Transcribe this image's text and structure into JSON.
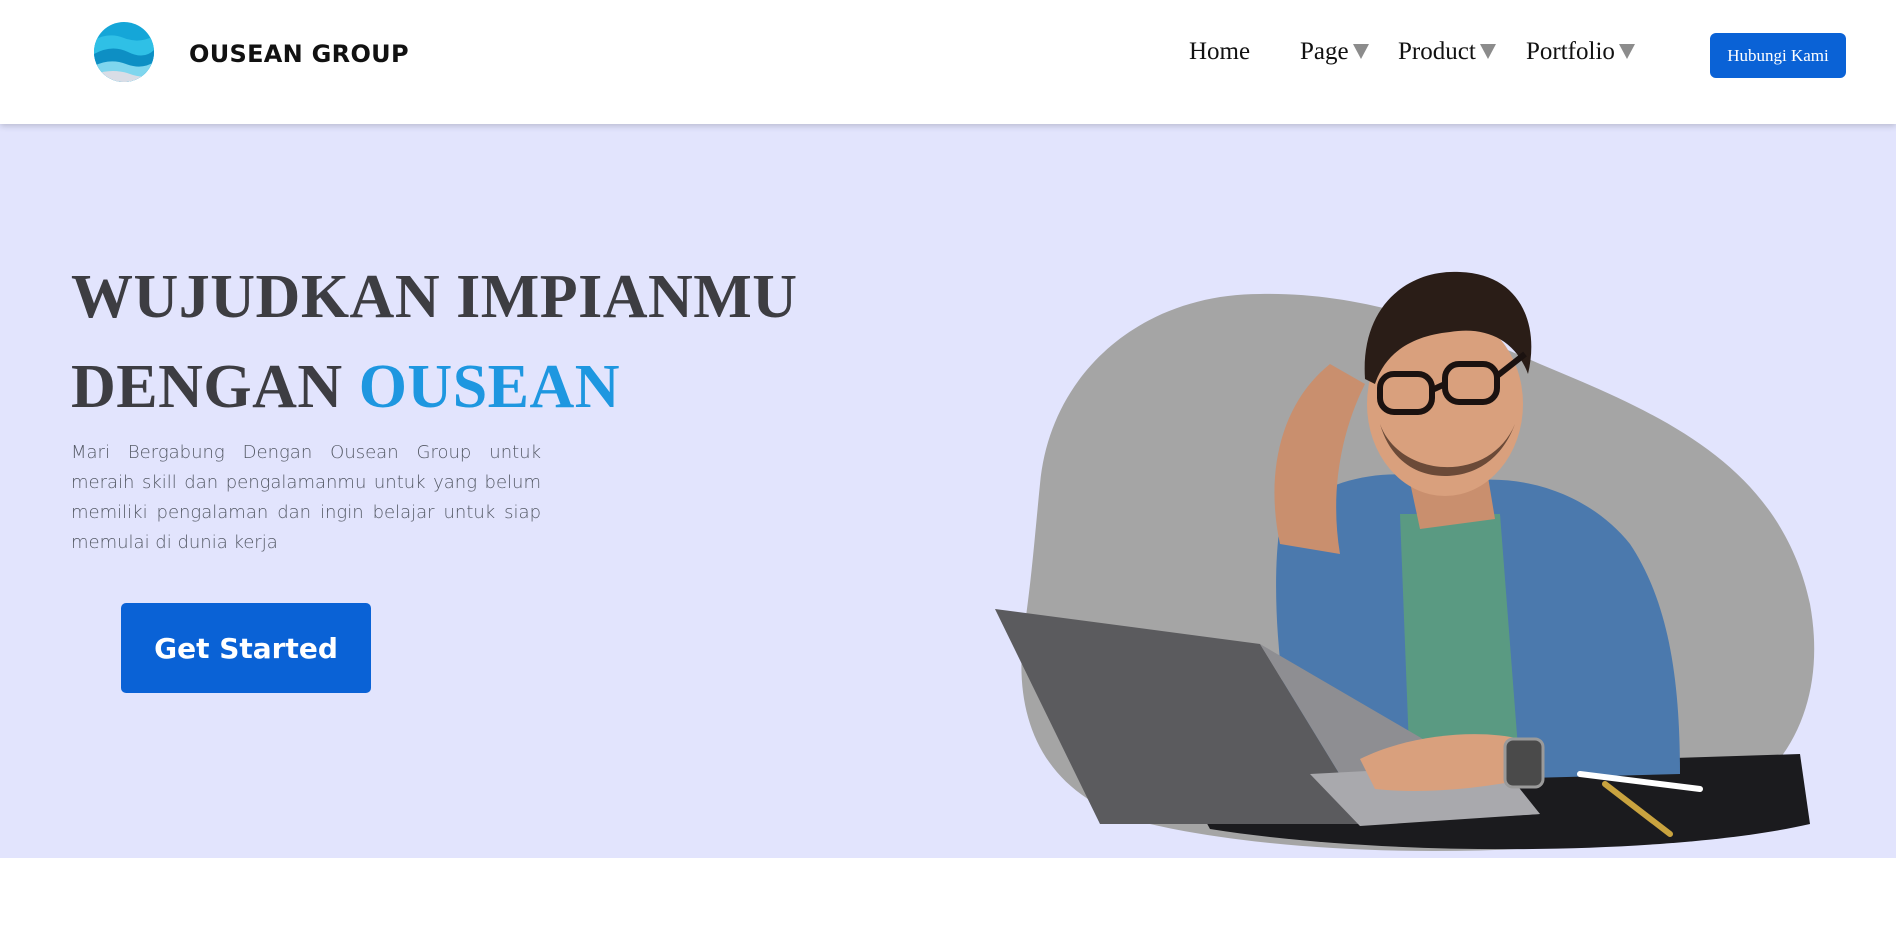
{
  "brand": {
    "name": "OUSEAN GROUP",
    "logo_icon": "ocean-wave-logo"
  },
  "nav": {
    "items": [
      {
        "label": "Home",
        "dropdown": false
      },
      {
        "label": "Page",
        "dropdown": true
      },
      {
        "label": "Product",
        "dropdown": true
      },
      {
        "label": "Portfolio",
        "dropdown": true
      }
    ],
    "caret_icon": "caret-down-icon",
    "cta_label": "Hubungi Kami"
  },
  "hero": {
    "headline_line1": "WUJUDKAN IMPIANMU",
    "headline_line2_prefix": "DENGAN",
    "headline_line2_accent": "OUSEAN",
    "description": "Mari Bergabung Dengan Ousean Group untuk meraih skill dan pengalamanmu untuk yang belum memiliki pengalaman dan ingin belajar untuk siap memulai di dunia kerja",
    "cta_label": "Get Started"
  },
  "colors": {
    "primary": "#0a62d6",
    "accent": "#1e97e0",
    "hero_bg": "#e2e4fd",
    "heading": "#3d3d42",
    "blob": "#a5a5a5"
  }
}
